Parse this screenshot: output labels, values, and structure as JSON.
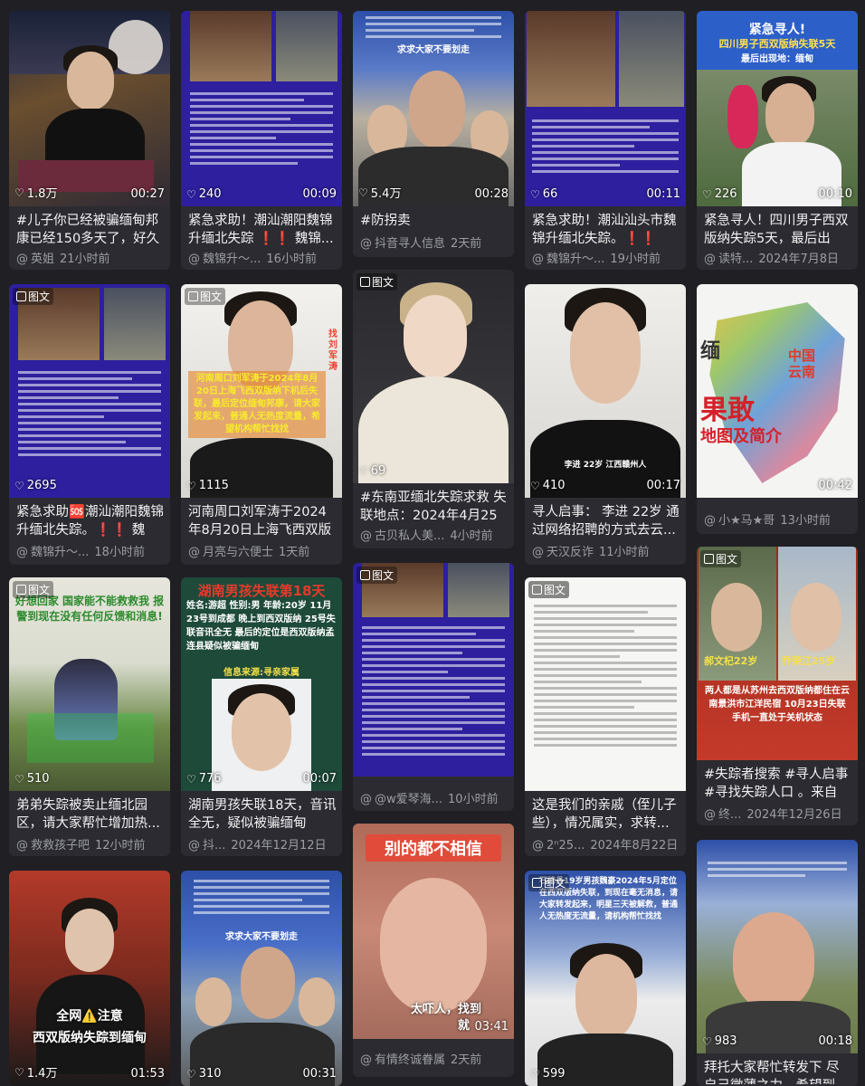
{
  "cards": [
    {
      "id": "c1",
      "tag": "",
      "likes": "1.8万",
      "duration": "00:27",
      "title": "#儿子你已经被骗缅甸邦康已经150多天了，好久没...",
      "author": "英姐",
      "time": "21小时前"
    },
    {
      "id": "c2",
      "tag": "",
      "likes": "240",
      "duration": "00:09",
      "title": "紧急求助！潮汕潮阳魏锦升缅北失踪 ❗❗ 魏锦...",
      "author": "魏锦升～...",
      "time": "16小时前"
    },
    {
      "id": "c3",
      "tag": "",
      "likes": "5.4万",
      "duration": "00:28",
      "title": "#防拐卖",
      "author": "抖音寻人信息",
      "time": "2天前",
      "overlay": "求求大家不要划走"
    },
    {
      "id": "c4",
      "tag": "",
      "likes": "66",
      "duration": "00:11",
      "title": "紧急求助！潮汕汕头市魏锦升缅北失踪。❗❗ 魏...",
      "author": "魏锦升～...",
      "time": "19小时前"
    },
    {
      "id": "c5",
      "tag": "",
      "likes": "226",
      "duration": "00:10",
      "title": "紧急寻人！四川男子西双版纳失踪5天，最后出现...",
      "author": "读特...",
      "time": "2024年7月8日",
      "overlay": "紧急寻人!",
      "overlay2": "四川男子西双版纳失联5天",
      "overlay3": "最后出现地：缅甸"
    },
    {
      "id": "c6",
      "tag": "图文",
      "likes": "2695",
      "duration": "",
      "title": "紧急求助🆘潮汕潮阳魏锦升缅北失踪。❗❗ 魏锦...",
      "author": "魏锦升～...",
      "time": "18小时前"
    },
    {
      "id": "c7",
      "tag": "图文",
      "likes": "1115",
      "duration": "",
      "title": "河南周口刘军涛于2024年8月20日上海飞西双版纳...",
      "author": "月亮与六便士",
      "time": "1天前",
      "overlay": "河南周口刘军涛于2024年8月20日上海飞西双版纳下机后失联，最后定位缅甸邦康，请大家发起来，普通人无热度流量，希望机构帮忙找找"
    },
    {
      "id": "c8",
      "tag": "图文",
      "likes": "69",
      "duration": "",
      "title": "#东南亚缅北失踪求救 失联地点：2024年4月25日...",
      "author": "古贝私人美...",
      "time": "4小时前"
    },
    {
      "id": "c9",
      "tag": "",
      "likes": "410",
      "duration": "00:17",
      "title": "寻人启事： 李进 22岁 通过网络招聘的方式去云...",
      "author": "天汉反诈",
      "time": "11小时前",
      "overlay": "李进  22岁  江西赣州人"
    },
    {
      "id": "c10",
      "tag": "",
      "likes": "",
      "duration": "00:42",
      "title": "",
      "author": "小★马★哥",
      "time": "13小时前",
      "overlay": "果敢",
      "overlay2": "地图及简介",
      "overlay3": "中国云南",
      "overlay4": "缅"
    },
    {
      "id": "c11",
      "tag": "图文",
      "likes": "510",
      "duration": "",
      "title": "弟弟失踪被卖止缅北园区，请大家帮忙增加热...",
      "author": "救救孩子吧",
      "time": "12小时前",
      "overlay": "好想回家 国家能不能救救我 报警到现在没有任何反馈和消息!"
    },
    {
      "id": "c12",
      "tag": "",
      "likes": "776",
      "duration": "00:07",
      "title": "湖南男孩失联18天，音讯全无，疑似被骗缅甸 #d...",
      "author": "抖...",
      "time": "2024年12月12日",
      "overlay": "湖南男孩失联第18天",
      "overlay2": "姓名:游超 性别:男 年龄:20岁 11月23号到成都 晚上到西双版纳 25号失联音讯全无 最后的定位是西双版纳孟连县疑似被骗缅甸",
      "overlay3": "信息来源:寻亲家属"
    },
    {
      "id": "c13",
      "tag": "图文",
      "likes": "",
      "duration": "",
      "title": "",
      "author": "@w爱琴海...",
      "time": "10小时前"
    },
    {
      "id": "c14",
      "tag": "图文",
      "likes": "",
      "duration": "",
      "title": "这是我们的亲戚（侄儿子些），情况属实，求转...",
      "author": "2ⁿ25...",
      "time": "2024年8月22日"
    },
    {
      "id": "c15",
      "tag": "图文",
      "likes": "",
      "duration": "",
      "title": "#失踪者搜索 #寻人启事 #寻找失踪人口 。来自一...",
      "author": "终...",
      "time": "2024年12月26日",
      "overlay": "郝文杞22岁",
      "overlay2": "乔荣江25岁",
      "overlay3": "两人都是从苏州去西双版纳都住在云南景洪市江洋民宿 10月23日失联 手机一直处于关机状态"
    },
    {
      "id": "c16",
      "tag": "",
      "likes": "1.4万",
      "duration": "01:53",
      "title": "",
      "author": "",
      "time": "",
      "overlay": "全网⚠️注意",
      "overlay2": "西双版纳失踪到缅甸"
    },
    {
      "id": "c17",
      "tag": "",
      "likes": "310",
      "duration": "00:31",
      "title": "",
      "author": "",
      "time": "",
      "overlay": "求求大家不要划走"
    },
    {
      "id": "c18",
      "tag": "",
      "likes": "",
      "duration": "03:41",
      "title": "",
      "author": "有情终诚眷属",
      "time": "2天前",
      "overlay": "别的都不相信",
      "overlay2": "太吓人，找到",
      "overlay3": "就"
    },
    {
      "id": "c19",
      "tag": "图文",
      "likes": "599",
      "duration": "",
      "title": "",
      "author": "",
      "time": "",
      "overlay": "石榜县19岁男孩魏豪2024年5月定位在西双版纳失联，到现在毫无消息，请大家转发起来，明星三天被解救，普通人无热度无流量，请机构帮忙找找"
    },
    {
      "id": "c20",
      "tag": "",
      "likes": "983",
      "duration": "00:18",
      "title": "拜托大家帮忙转发下 尽自己微薄之力，希望到家...",
      "author": "",
      "time": ""
    }
  ]
}
